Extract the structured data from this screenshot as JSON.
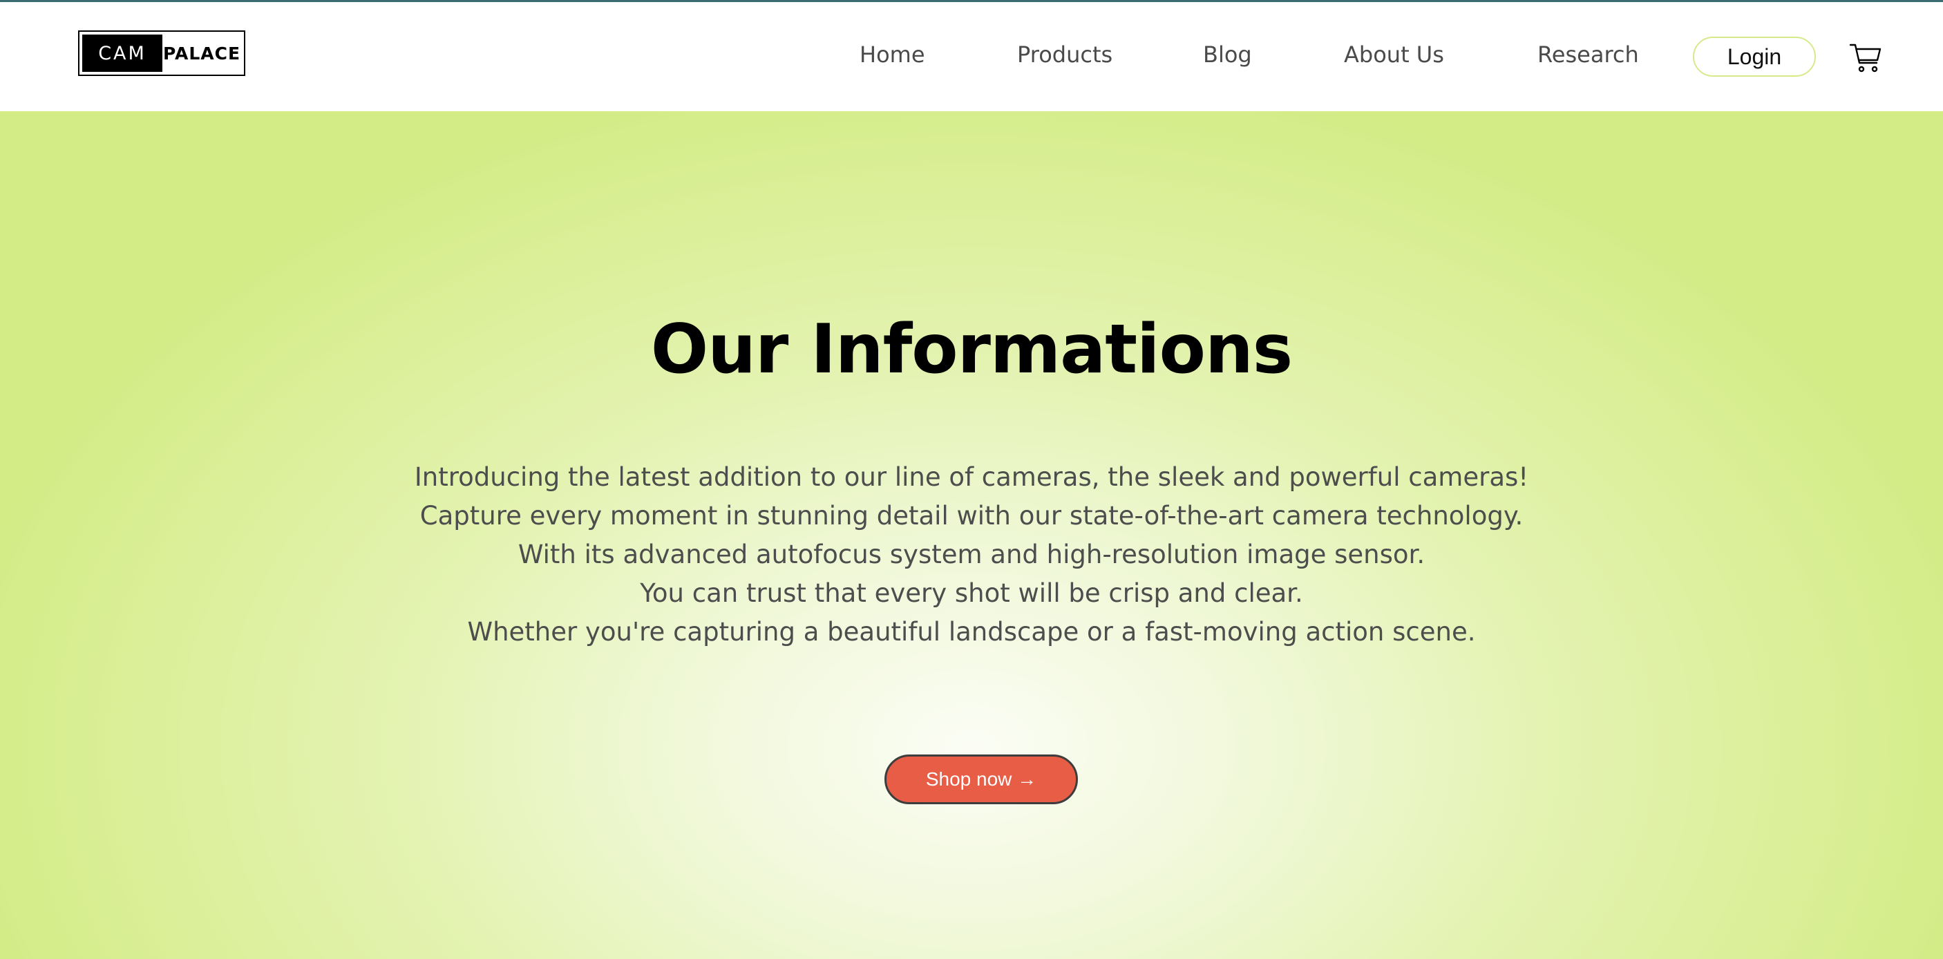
{
  "brand": {
    "logo_left": "CAM",
    "logo_right": "PALACE"
  },
  "nav": {
    "items": [
      {
        "label": "Home"
      },
      {
        "label": "Products"
      },
      {
        "label": "Blog"
      },
      {
        "label": "About Us"
      },
      {
        "label": "Research"
      }
    ],
    "login_label": "Login",
    "cart_icon": "shopping-cart-icon"
  },
  "hero": {
    "title": "Our Informations",
    "lines": [
      "Introducing the latest addition to our line of cameras, the sleek and powerful cameras!",
      "Capture every moment in stunning detail with our state-of-the-art camera technology.",
      "With its advanced autofocus system and high-resolution image sensor.",
      "You can trust that every shot will be crisp and clear.",
      "Whether you're capturing a beautiful landscape or a fast-moving action scene."
    ],
    "cta_label": "Shop now →"
  },
  "colors": {
    "hero_edge": "#d3ec85",
    "hero_center": "#fbfdf5",
    "cta_background": "#e85d46",
    "login_border": "#d6ea8c",
    "nav_text": "#4a4a4a"
  }
}
